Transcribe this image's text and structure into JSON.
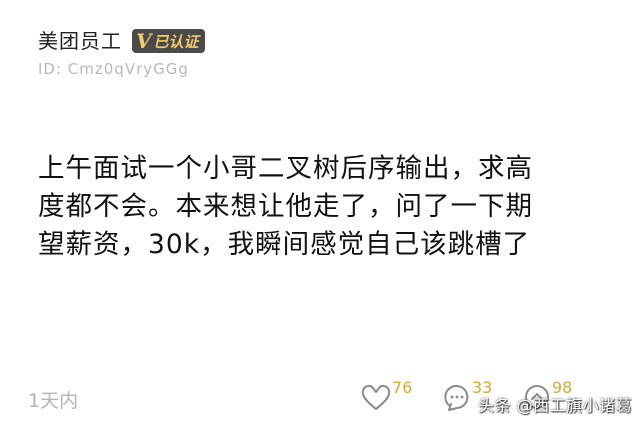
{
  "author": {
    "name": "美团员工",
    "badge_v": "V",
    "badge_text": "已认证",
    "id_text": "ID:  Cmz0qVryGGg"
  },
  "post": {
    "lines": [
      "上午面试一个小哥二叉树后序输出，求高",
      "度都不会。本来想让他走了，问了一下期",
      "望薪资，30k，我瞬间感觉自己该跳槽了"
    ],
    "time": "1天内"
  },
  "stats": {
    "likes": "76",
    "comments": "33",
    "shares": "98"
  },
  "watermark": "头条 @西工旗小诸葛",
  "colors": {
    "badge_bg": "#4a4a4a",
    "badge_text": "#f2c86a",
    "count_text": "#d9a830",
    "muted_text": "#b4b4b4"
  },
  "icons": [
    "heart-icon",
    "comment-icon",
    "share-icon"
  ]
}
